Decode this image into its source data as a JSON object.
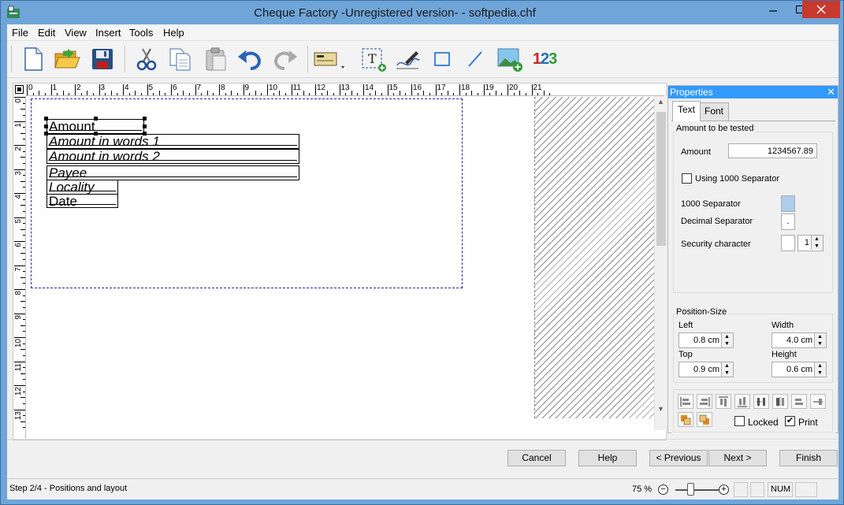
{
  "window": {
    "title": "Cheque Factory -Unregistered version- - softpedia.chf"
  },
  "menu": [
    "File",
    "Edit",
    "View",
    "Insert",
    "Tools",
    "Help"
  ],
  "toolbar": {
    "tools": [
      "new-file-icon",
      "open-folder-icon",
      "save-icon",
      "cut-icon",
      "copy-icon",
      "paste-icon",
      "undo-icon",
      "redo-icon",
      "cheque-template-icon",
      "text-field-icon",
      "signature-icon",
      "rectangle-icon",
      "line-icon",
      "image-icon",
      "number-field-icon"
    ],
    "number_icon_text": "123"
  },
  "ruler": {
    "top": [
      "0",
      "1",
      "2",
      "3",
      "4",
      "5",
      "6",
      "7",
      "8",
      "9",
      "10",
      "11",
      "12",
      "13",
      "14",
      "15",
      "16",
      "17",
      "18",
      "19",
      "20",
      "21"
    ],
    "left": [
      "0",
      "1",
      "2",
      "3",
      "4",
      "5",
      "6",
      "7",
      "8",
      "9",
      "10",
      "11",
      "12",
      "13"
    ]
  },
  "cheque_fields": [
    {
      "label": "Amount"
    },
    {
      "label": "Amount in words 1"
    },
    {
      "label": "Amount in words 2"
    },
    {
      "label": "Payee"
    },
    {
      "label": "Locality"
    },
    {
      "label": "Date"
    }
  ],
  "properties": {
    "title": "Properties",
    "tabs": [
      "Text",
      "Font"
    ],
    "amount_group": "Amount to be tested",
    "amount_label": "Amount",
    "amount_value": "1234567.89",
    "using_separator_label": "Using 1000 Separator",
    "using_separator_checked": false,
    "thousand_sep_label": "1000 Separator",
    "decimal_sep_label": "Decimal Separator",
    "decimal_sep_value": ".",
    "security_char_label": "Security  character",
    "security_char_value": "1",
    "position_group": "Position-Size",
    "left_label": "Left",
    "left_value": "0.8 cm",
    "width_label": "Width",
    "width_value": "4.0 cm",
    "top_label": "Top",
    "top_value": "0.9 cm",
    "height_label": "Height",
    "height_value": "0.6 cm",
    "locked_label": "Locked",
    "locked_checked": false,
    "print_label": "Print",
    "print_checked": true,
    "print_mark": "✔"
  },
  "buttons": {
    "cancel": "Cancel",
    "help": "Help",
    "previous": "< Previous",
    "next": "Next >",
    "finish": "Finish"
  },
  "status": {
    "step": "Step 2/4 - Positions and layout",
    "zoom": "75 %",
    "zoom_percent": 75,
    "num": "NUM"
  },
  "colors": {
    "titlebar": "#6fa5d8",
    "close_button": "#c7392e",
    "panel_title": "#3399ff",
    "cheque_border": "#2a2a9a"
  }
}
